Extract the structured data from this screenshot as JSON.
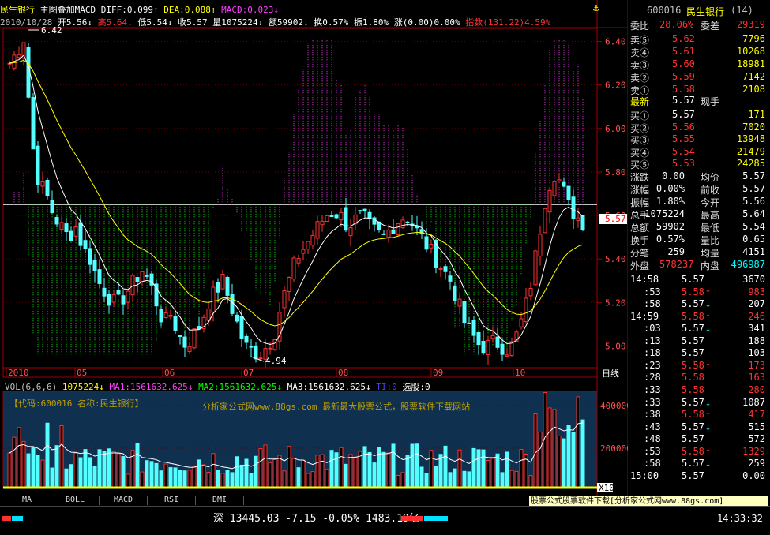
{
  "header": {
    "stock_name": "民生银行",
    "overlay": "主图叠加MACD",
    "diff": "DIFF:0.099",
    "dea": "DEA:0.088",
    "macd": "MACD:0.023",
    "date": "2010/10/28",
    "open": "开5.56",
    "high": "高5.64",
    "low": "低5.54",
    "close": "收5.57",
    "volume": "量1075224",
    "amount": "额59902",
    "turnover": "换0.57%",
    "amplitude": "振1.80%",
    "change": "涨(0.00)0.00%",
    "index": "指数(131.22)4.59%"
  },
  "price_axis": {
    "labels": [
      "6.40",
      "6.20",
      "6.00",
      "5.80",
      "5.60",
      "5.40",
      "5.20",
      "5.00"
    ],
    "current_price_tag": "5.57",
    "high_marker": "6.42",
    "low_marker": "4.94"
  },
  "time_axis": {
    "labels": [
      "2010",
      "05",
      "06",
      "07",
      "08",
      "09",
      "10"
    ],
    "period_label": "日线"
  },
  "volume_header": {
    "name": "VOL(6,6,6)",
    "vol": "1075224",
    "ma1": "MA1:1561632.625",
    "ma2": "MA2:1561632.625",
    "ma3": "MA3:1561632.625",
    "ti": "TI:0",
    "pick": "选股:0"
  },
  "volume_panel": {
    "code_label": "【代码:600016  名称:民生银行】",
    "ad_text": "分析家公式网www.88gs.com  最新最大股票公式，股票软件下载网站",
    "axis_labels": [
      "400000",
      "200000",
      "0"
    ],
    "unit": "X10"
  },
  "indicator_tabs": [
    "MA",
    "BOLL",
    "MACD",
    "RSI",
    "DMI"
  ],
  "quote": {
    "code": "600016",
    "name": "民生银行",
    "suffix": "(14)",
    "weibi_label": "委比",
    "weibi": "28.06%",
    "weicha_label": "委差",
    "weicha": "29319",
    "sells": [
      {
        "label": "卖⑤",
        "price": "5.62",
        "vol": "7796"
      },
      {
        "label": "卖④",
        "price": "5.61",
        "vol": "10268"
      },
      {
        "label": "卖③",
        "price": "5.60",
        "vol": "18981"
      },
      {
        "label": "卖②",
        "price": "5.59",
        "vol": "7142"
      },
      {
        "label": "卖①",
        "price": "5.58",
        "vol": "2108"
      }
    ],
    "latest_label": "最新",
    "latest": "5.57",
    "current_hand_label": "现手",
    "buys": [
      {
        "label": "买①",
        "price": "5.57",
        "vol": "171"
      },
      {
        "label": "买②",
        "price": "5.56",
        "vol": "7020"
      },
      {
        "label": "买③",
        "price": "5.55",
        "vol": "13948"
      },
      {
        "label": "买④",
        "price": "5.54",
        "vol": "21479"
      },
      {
        "label": "买⑤",
        "price": "5.53",
        "vol": "24285"
      }
    ],
    "stats": [
      {
        "l1": "涨跌",
        "v1": "0.00",
        "l2": "均价",
        "v2": "5.57"
      },
      {
        "l1": "涨幅",
        "v1": "0.00%",
        "l2": "前收",
        "v2": "5.57"
      },
      {
        "l1": "振幅",
        "v1": "1.80%",
        "l2": "今开",
        "v2": "5.56"
      },
      {
        "l1": "总手",
        "v1": "1075224",
        "l2": "最高",
        "v2": "5.64"
      },
      {
        "l1": "总额",
        "v1": "59902",
        "l2": "最低",
        "v2": "5.54"
      },
      {
        "l1": "换手",
        "v1": "0.57%",
        "l2": "量比",
        "v2": "0.65"
      },
      {
        "l1": "分笔",
        "v1": "259",
        "l2": "均量",
        "v2": "4151"
      }
    ],
    "outer_label": "外盘",
    "outer": "578237",
    "inner_label": "内盘",
    "inner": "496987"
  },
  "ticks": [
    {
      "time": "14:58",
      "price": "5.57",
      "arrow": "",
      "vol": "3670",
      "color": "white"
    },
    {
      "time": ":53",
      "price": "5.58",
      "arrow": "↑",
      "vol": "983",
      "color": "red"
    },
    {
      "time": ":58",
      "price": "5.57",
      "arrow": "↓",
      "vol": "207",
      "color": "white"
    },
    {
      "time": "14:59",
      "price": "5.58",
      "arrow": "↑",
      "vol": "246",
      "color": "red"
    },
    {
      "time": ":03",
      "price": "5.57",
      "arrow": "↓",
      "vol": "341",
      "color": "white"
    },
    {
      "time": ":13",
      "price": "5.57",
      "arrow": "",
      "vol": "188",
      "color": "white"
    },
    {
      "time": ":18",
      "price": "5.57",
      "arrow": "",
      "vol": "103",
      "color": "white"
    },
    {
      "time": ":23",
      "price": "5.58",
      "arrow": "↑",
      "vol": "173",
      "color": "red"
    },
    {
      "time": ":28",
      "price": "5.58",
      "arrow": "",
      "vol": "163",
      "color": "red"
    },
    {
      "time": ":33",
      "price": "5.58",
      "arrow": "",
      "vol": "280",
      "color": "red"
    },
    {
      "time": ":33",
      "price": "5.57",
      "arrow": "↓",
      "vol": "1087",
      "color": "white"
    },
    {
      "time": ":38",
      "price": "5.58",
      "arrow": "↑",
      "vol": "417",
      "color": "red"
    },
    {
      "time": ":43",
      "price": "5.57",
      "arrow": "↓",
      "vol": "515",
      "color": "white"
    },
    {
      "time": ":48",
      "price": "5.57",
      "arrow": "",
      "vol": "572",
      "color": "white"
    },
    {
      "time": ":53",
      "price": "5.58",
      "arrow": "↑",
      "vol": "1329",
      "color": "red"
    },
    {
      "time": ":58",
      "price": "5.57",
      "arrow": "↓",
      "vol": "259",
      "color": "white"
    },
    {
      "time": "15:00",
      "price": "5.57",
      "arrow": "",
      "vol": "0.00",
      "color": "white"
    }
  ],
  "ad_banner": "股票公式股票软件下载[分析家公式网www.88gs.com]",
  "status": {
    "market": "深",
    "index": "13445.03",
    "change": "-7.15",
    "pct": "-0.05%",
    "amount": "1483.19亿",
    "time": "14:33:32"
  },
  "colors": {
    "up": "#ff3232",
    "down": "#54ffff",
    "diff_line": "#ffffff",
    "dea_line": "#ffff00",
    "macd_pos": "#ff40ff",
    "macd_neg": "#00ff00"
  },
  "icons": [
    "anchor-icon"
  ]
}
